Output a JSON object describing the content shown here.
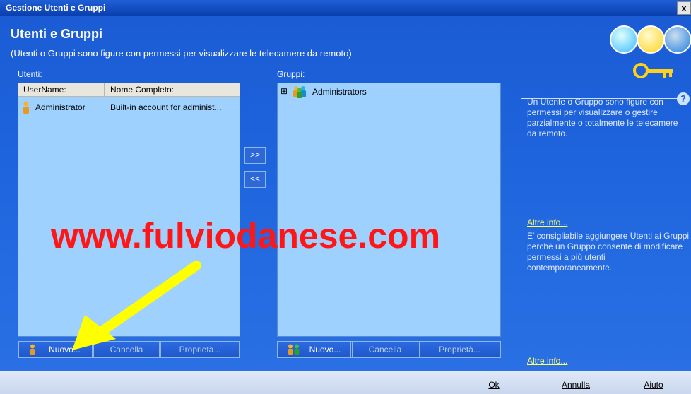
{
  "window": {
    "title": "Gestione Utenti e Gruppi",
    "close": "x"
  },
  "header": {
    "title": "Utenti e Gruppi",
    "subtitle": "(Utenti o Gruppi sono figure con permessi per visualizzare le telecamere da remoto)"
  },
  "users": {
    "label": "Utenti:",
    "columns": [
      "UserName:",
      "Nome Completo:"
    ],
    "rows": [
      {
        "username": "Administrator",
        "fullname": "Built-in account for administ..."
      }
    ],
    "buttons": {
      "new": "Nuovo...",
      "delete": "Cancella",
      "properties": "Proprietà..."
    }
  },
  "groups": {
    "label": "Gruppi:",
    "tree": [
      {
        "expander": "⊞",
        "name": "Administrators"
      }
    ],
    "buttons": {
      "new": "Nuovo...",
      "delete": "Cancella",
      "properties": "Proprietà..."
    }
  },
  "move": {
    "add": ">>",
    "remove": "<<"
  },
  "help": {
    "q": "?",
    "text1": "Un Utente o Gruppo sono figure con permessi per visualizzare o gestire parzialmente o totalmente le telecamere da remoto.",
    "link1": "Altre info...",
    "text2": "E' consigliabile aggiungere Utenti ai Gruppi perchè un Gruppo consente di modificare permessi a più utenti contemporaneamente.",
    "link2": "Altre info..."
  },
  "watermark": "www.fulviodanese.com",
  "footer": {
    "ok": "Ok",
    "cancel": "Annulla",
    "help": "Aiuto"
  },
  "colors": {
    "panel": "#9fd1ff",
    "window_blue": "#1e64dd",
    "watermark": "#ff1616",
    "arrow": "#ffff00"
  },
  "icons": [
    "user-icon",
    "group-icon",
    "smiley-faces-icon",
    "key-icon",
    "help-icon",
    "tree-expand-icon",
    "arrow-annotation-icon"
  ]
}
